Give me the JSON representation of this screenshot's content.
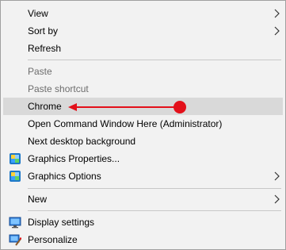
{
  "menu": {
    "view": "View",
    "sort_by": "Sort by",
    "refresh": "Refresh",
    "paste": "Paste",
    "paste_shortcut": "Paste shortcut",
    "chrome": "Chrome",
    "open_cmd": "Open Command Window Here (Administrator)",
    "next_bg": "Next desktop background",
    "graphics_properties": "Graphics Properties...",
    "graphics_options": "Graphics Options",
    "new": "New",
    "display_settings": "Display settings",
    "personalize": "Personalize"
  },
  "colors": {
    "hover_bg": "#d9d9d9",
    "annotation_red": "#e3101a",
    "disabled_text": "#6d6d6d"
  },
  "icons": {
    "graphics_properties": "intel-graphics-icon",
    "graphics_options": "intel-graphics-icon",
    "display_settings": "display-monitor-icon",
    "personalize": "personalize-paintbrush-icon"
  }
}
